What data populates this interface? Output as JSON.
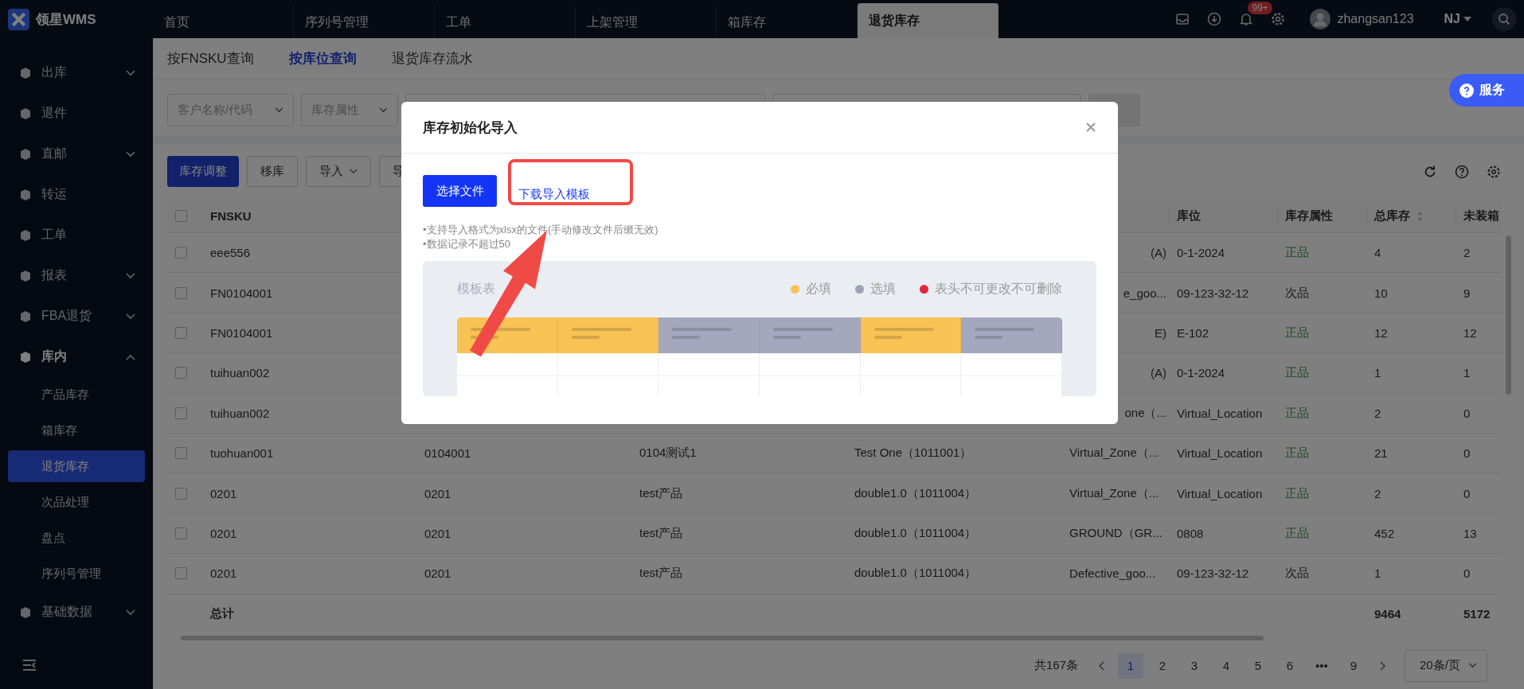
{
  "app": {
    "name": "领星WMS"
  },
  "top_tabs": [
    {
      "label": "首页",
      "selected": false
    },
    {
      "label": "序列号管理",
      "selected": false
    },
    {
      "label": "工单",
      "selected": false
    },
    {
      "label": "上架管理",
      "selected": false
    },
    {
      "label": "箱库存",
      "selected": false
    },
    {
      "label": "退货库存",
      "selected": true
    }
  ],
  "header": {
    "notification_badge": "99+",
    "user": "zhangsan123",
    "warehouse": "NJ"
  },
  "sidebar": {
    "items": [
      {
        "label": "出库",
        "expandable": true,
        "expanded": false
      },
      {
        "label": "退件",
        "expandable": false,
        "expanded": false
      },
      {
        "label": "直邮",
        "expandable": true,
        "expanded": false
      },
      {
        "label": "转运",
        "expandable": false,
        "expanded": false
      },
      {
        "label": "工单",
        "expandable": false,
        "expanded": false
      },
      {
        "label": "报表",
        "expandable": true,
        "expanded": false
      },
      {
        "label": "FBA退货",
        "expandable": true,
        "expanded": false
      },
      {
        "label": "库内",
        "expandable": true,
        "expanded": true,
        "children": [
          {
            "label": "产品库存",
            "selected": false
          },
          {
            "label": "箱库存",
            "selected": false
          },
          {
            "label": "退货库存",
            "selected": true
          },
          {
            "label": "次品处理",
            "selected": false
          },
          {
            "label": "盘点",
            "selected": false
          },
          {
            "label": "序列号管理",
            "selected": false
          }
        ]
      },
      {
        "label": "基础数据",
        "expandable": true,
        "expanded": false
      }
    ]
  },
  "sub_tabs": [
    {
      "label": "按FNSKU查询",
      "selected": false
    },
    {
      "label": "按库位查询",
      "selected": true
    },
    {
      "label": "退货库存流水",
      "selected": false
    }
  ],
  "filters": [
    {
      "placeholder": "客户名称/代码"
    },
    {
      "placeholder": "库存属性"
    }
  ],
  "service_button": {
    "label": "服务"
  },
  "toolbar": {
    "buttons": [
      {
        "label": "库存调整",
        "kind": "primary"
      },
      {
        "label": "移库",
        "kind": "default"
      },
      {
        "label": "导入",
        "kind": "dropdown"
      },
      {
        "label": "导",
        "kind": "default"
      }
    ]
  },
  "table": {
    "headers": {
      "fnsku": "FNSKU",
      "location": "库位",
      "attribute": "库存属性",
      "total": "总库存",
      "unboxed": "未装箱"
    },
    "all_checked": false,
    "rows": [
      {
        "checked": false,
        "fnsku": "eee556",
        "column_5": "(A)",
        "location": "0-1-2024",
        "attribute": "正品",
        "kind": "good",
        "total": "4",
        "unboxed": "2"
      },
      {
        "checked": false,
        "fnsku": "FN0104001",
        "column_5": "e_goo...",
        "location": "09-123-32-12",
        "attribute": "次品",
        "kind": "defective",
        "total": "10",
        "unboxed": "9"
      },
      {
        "checked": false,
        "fnsku": "FN0104001",
        "column_5": "E)",
        "location": "E-102",
        "attribute": "正品",
        "kind": "good",
        "total": "12",
        "unboxed": "12"
      },
      {
        "checked": false,
        "fnsku": "tuihuan002",
        "column_5": "(A)",
        "location": "0-1-2024",
        "attribute": "正品",
        "kind": "good",
        "total": "1",
        "unboxed": "1"
      },
      {
        "checked": false,
        "fnsku": "tuihuan002",
        "column_5": "one（...",
        "location": "Virtual_Location",
        "attribute": "正品",
        "kind": "good",
        "total": "2",
        "unboxed": "0"
      },
      {
        "checked": false,
        "fnsku": "tuohuan001",
        "column_2": "0104001",
        "column_3": "0104测试1",
        "column_4": "Test One（1011001）",
        "column_5": "Virtual_Zone（...",
        "location": "Virtual_Location",
        "attribute": "正品",
        "kind": "good",
        "total": "21",
        "unboxed": "0"
      },
      {
        "checked": false,
        "fnsku": "0201",
        "column_2": "0201",
        "column_3": "test产品",
        "column_4": "double1.0（1011004）",
        "column_5": "Virtual_Zone（...",
        "location": "Virtual_Location",
        "attribute": "正品",
        "kind": "good",
        "total": "2",
        "unboxed": "0"
      },
      {
        "checked": false,
        "fnsku": "0201",
        "column_2": "0201",
        "column_3": "test产品",
        "column_4": "double1.0（1011004）",
        "column_5": "GROUND（GR...",
        "location": "0808",
        "attribute": "正品",
        "kind": "good",
        "total": "452",
        "unboxed": "13"
      },
      {
        "checked": false,
        "fnsku": "0201",
        "column_2": "0201",
        "column_3": "test产品",
        "column_4": "double1.0（1011004）",
        "column_5": "Defective_goo...",
        "location": "09-123-32-12",
        "attribute": "次品",
        "kind": "defective",
        "total": "1",
        "unboxed": "0"
      }
    ],
    "total_row": {
      "label": "总计",
      "total": "9464",
      "unboxed": "5172"
    }
  },
  "pagination": {
    "total": "共167条",
    "pages": [
      {
        "label": "1",
        "selected": true
      },
      {
        "label": "2",
        "selected": false
      },
      {
        "label": "3",
        "selected": false
      },
      {
        "label": "4",
        "selected": false
      },
      {
        "label": "5",
        "selected": false
      },
      {
        "label": "6",
        "selected": false
      },
      {
        "label": "•••",
        "selected": false
      },
      {
        "label": "9",
        "selected": false
      }
    ],
    "page_size": "20条/页"
  },
  "dialog": {
    "title": "库存初始化导入",
    "select_file_button": "选择文件",
    "download_link": "下载导入模板",
    "notes": [
      "•支持导入格式为xlsx的文件(手动修改文件后缀无效)",
      "•数据记录不超过50"
    ],
    "template": {
      "label": "模板表",
      "legend": [
        {
          "label": "必填",
          "color": "#f9c254"
        },
        {
          "label": "选填",
          "color": "#9ea2b8"
        },
        {
          "label": "表头不可更改不可删除",
          "color": "#e0283c"
        }
      ]
    }
  }
}
